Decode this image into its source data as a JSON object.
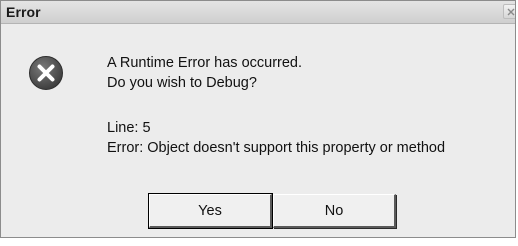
{
  "window": {
    "title": "Error"
  },
  "icon": {
    "name": "error-x-icon",
    "color": "#4a4a4a"
  },
  "message": {
    "line1": "A Runtime Error has occurred.",
    "line2": "Do you wish to Debug?",
    "detail_line": "Line: 5",
    "detail_error": "Error: Object doesn't support this property or method"
  },
  "buttons": {
    "yes_label": "Yes",
    "no_label": "No"
  }
}
